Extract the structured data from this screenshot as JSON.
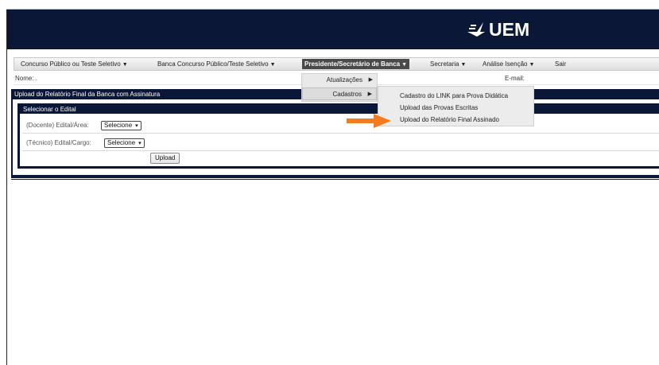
{
  "brand": {
    "logo_text": "UEM",
    "header_color": "#0b1736"
  },
  "menubar": {
    "items": [
      {
        "label": "Concurso Público ou Teste Seletivo",
        "caret": "▼"
      },
      {
        "label": "Banca Concurso Público/Teste Seletivo",
        "caret": "▼"
      },
      {
        "label": "Presidente/Secretário de Banca",
        "caret": "▼"
      },
      {
        "label": "Secretaria",
        "caret": "▼"
      },
      {
        "label": "Análise Isenção",
        "caret": "▼"
      },
      {
        "label": "Sair"
      }
    ]
  },
  "info": {
    "nome_label": "Nome: .",
    "email_label": "E-mail:"
  },
  "panel": {
    "title": "Upload do Relatório Final da Banca com Assinatura",
    "section_title": "Selecionar o Edital",
    "docente_label": "(Docente) Edital/Área:",
    "docente_value": "Selecione",
    "tecnico_label": "(Técnico) Edital/Cargo:",
    "tecnico_value": "Selecione",
    "upload_button": "Upload"
  },
  "dropdown": {
    "items": [
      {
        "label": "Atualizações",
        "arrow": "▶"
      },
      {
        "label": "Cadastros",
        "arrow": "▶"
      }
    ],
    "submenu": [
      {
        "label": "Cadastro do LINK para Prova Didática"
      },
      {
        "label": "Upload das Provas Escritas"
      },
      {
        "label": "Upload do Relatório Final Assinado"
      }
    ]
  },
  "colors": {
    "accent_arrow": "#f47c20",
    "active_menu": "#4a4a4a"
  }
}
